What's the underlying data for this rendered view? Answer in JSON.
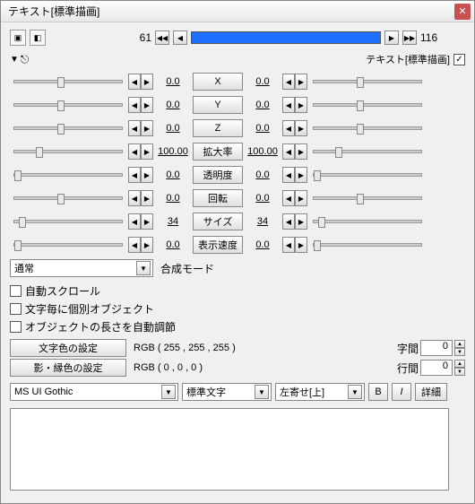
{
  "window": {
    "title": "テキスト[標準描画]"
  },
  "timeline": {
    "start": "61",
    "end": "116"
  },
  "section_label": "テキスト[標準描画]",
  "section_checked": "✓",
  "params": [
    {
      "name": "X",
      "l": "0.0",
      "r": "0.0",
      "lpos": 40,
      "rpos": 40
    },
    {
      "name": "Y",
      "l": "0.0",
      "r": "0.0",
      "lpos": 40,
      "rpos": 40
    },
    {
      "name": "Z",
      "l": "0.0",
      "r": "0.0",
      "lpos": 40,
      "rpos": 40
    },
    {
      "name": "拡大率",
      "l": "100.00",
      "r": "100.00",
      "lpos": 20,
      "rpos": 20
    },
    {
      "name": "透明度",
      "l": "0.0",
      "r": "0.0",
      "lpos": 0,
      "rpos": 0
    },
    {
      "name": "回転",
      "l": "0.0",
      "r": "0.0",
      "lpos": 40,
      "rpos": 40
    },
    {
      "name": "サイズ",
      "l": "34",
      "r": "34",
      "lpos": 4,
      "rpos": 4
    },
    {
      "name": "表示速度",
      "l": "0.0",
      "r": "0.0",
      "lpos": 0,
      "rpos": 0
    }
  ],
  "blend": {
    "label": "合成モード",
    "value": "通常"
  },
  "checks": {
    "auto_scroll": "自動スクロール",
    "per_char": "文字毎に個別オブジェクト",
    "auto_length": "オブジェクトの長さを自動調節"
  },
  "color": {
    "text_btn": "文字色の設定",
    "text_rgb": "RGB ( 255 , 255 , 255 )",
    "shadow_btn": "影・縁色の設定",
    "shadow_rgb": "RGB ( 0 , 0 , 0 )"
  },
  "spacing": {
    "char_label": "字間",
    "char_val": "0",
    "line_label": "行間",
    "line_val": "0"
  },
  "font": {
    "family": "MS UI Gothic",
    "style": "標準文字",
    "align": "左寄せ[上]",
    "bold": "B",
    "italic": "I",
    "detail": "詳細"
  }
}
